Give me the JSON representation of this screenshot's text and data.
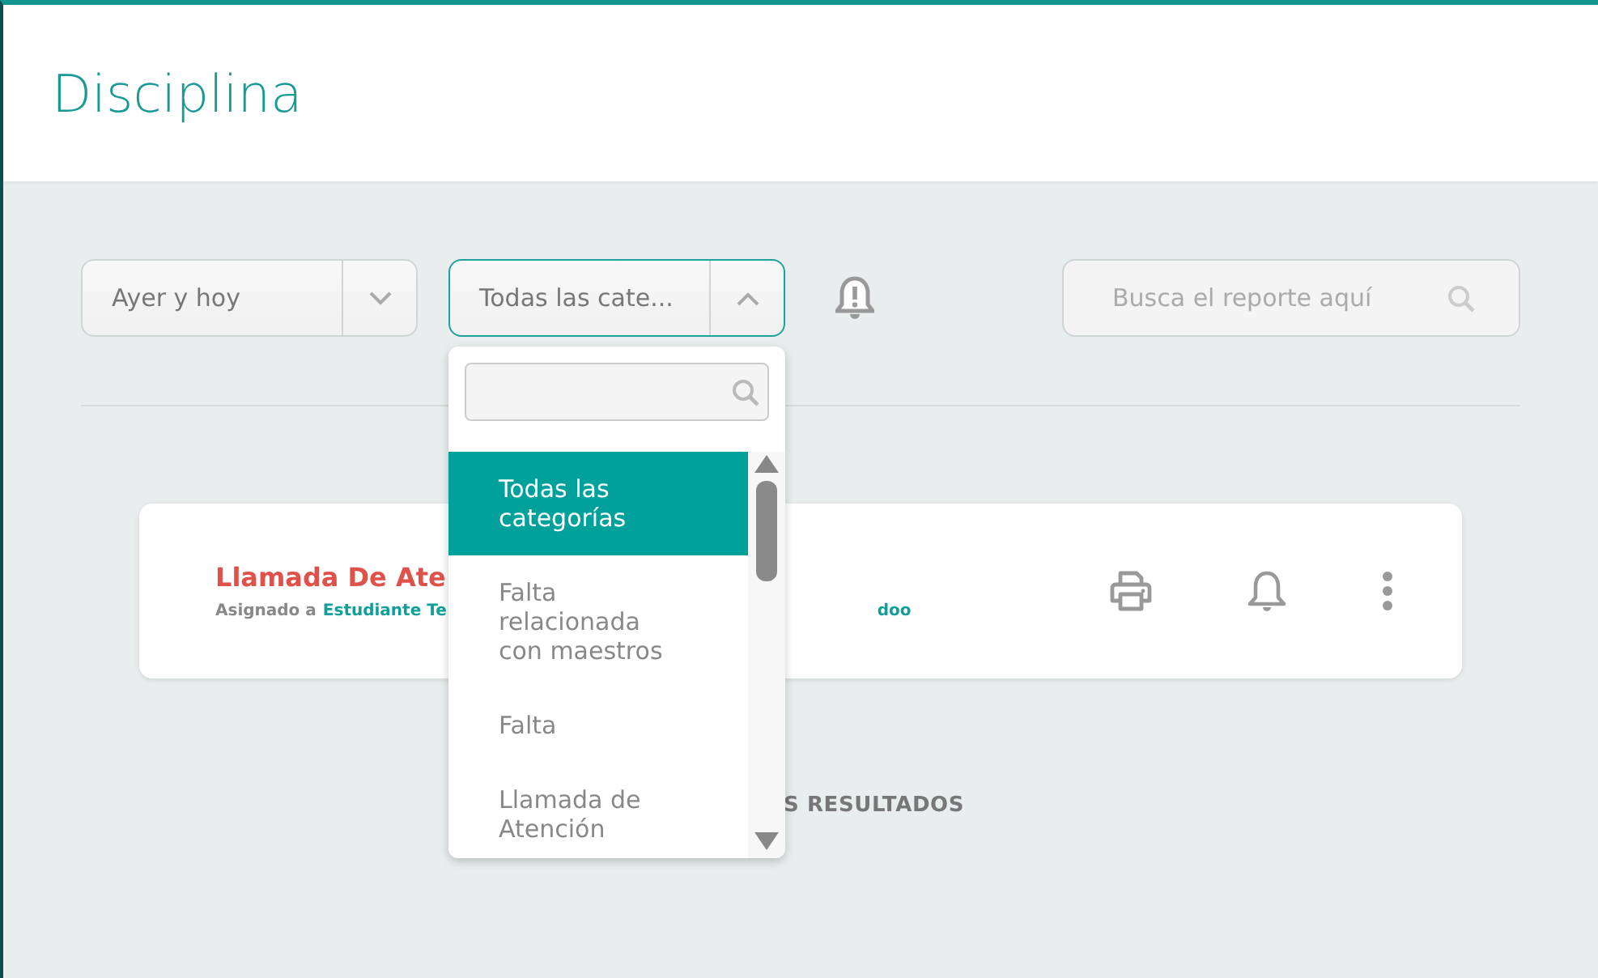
{
  "header": {
    "title": "Disciplina"
  },
  "filters": {
    "period": {
      "value": "Ayer y hoy",
      "expanded": false
    },
    "category": {
      "value": "Todas las cate...",
      "expanded": true,
      "options": [
        {
          "label": "Todas las categorías",
          "selected": true
        },
        {
          "label": "Falta relacionada con maestros",
          "selected": false
        },
        {
          "label": "Falta",
          "selected": false
        },
        {
          "label": "Llamada de Atención",
          "selected": false
        }
      ]
    }
  },
  "search": {
    "placeholder": "Busca el reporte aquí"
  },
  "report": {
    "title": "Llamada De Ate",
    "assigned_label": "Asignado a",
    "assignee": "Estudiante Te",
    "assignee_end": "doo"
  },
  "footer_text": "S RESULTADOS"
}
